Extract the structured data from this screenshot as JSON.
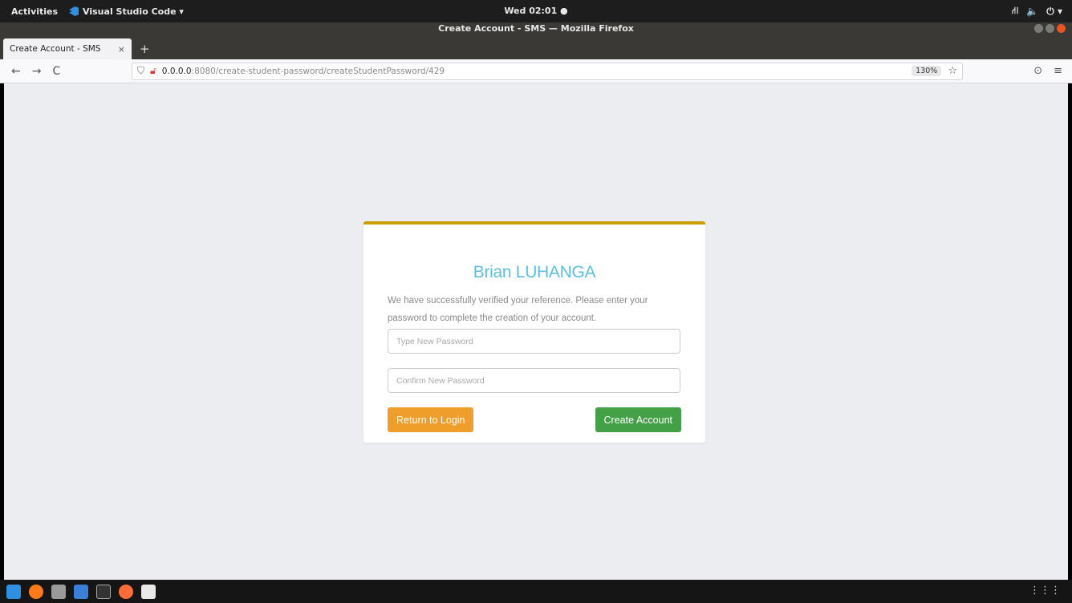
{
  "topbar": {
    "activities": "Activities",
    "app_name": "Visual Studio Code ▾",
    "clock": "Wed 02:01 ●",
    "tray": [
      "⛙",
      "🔈",
      "⏻ ▾"
    ]
  },
  "window": {
    "title": "Create Account - SMS — Mozilla Firefox"
  },
  "tabs": [
    {
      "label": "Create Account - SMS",
      "close": "×"
    }
  ],
  "new_tab": "+",
  "nav": {
    "back": "←",
    "forward": "→",
    "reload": "C",
    "url_host": "0.0.0.0",
    "url_rest": ":8080/create-student-password/createStudentPassword/429",
    "zoom": "130%",
    "bookmark": "☆",
    "pocket": "⊙",
    "menu": "≡"
  },
  "card": {
    "title": "Brian LUHANGA",
    "message": "We have successfully verified your reference. Please enter your password to complete the creation of your account.",
    "password_placeholder": "Type New Password",
    "confirm_placeholder": "Confirm New Password",
    "return_label": "Return to Login",
    "create_label": "Create Account",
    "accent_color": "#c9a000"
  },
  "dock": {
    "apps": [
      "vscode-icon",
      "firefox-icon",
      "files-icon",
      "pycharm-icon",
      "terminal-icon",
      "postman-icon",
      "text-editor-icon"
    ],
    "app_grid": "⋮⋮⋮"
  }
}
